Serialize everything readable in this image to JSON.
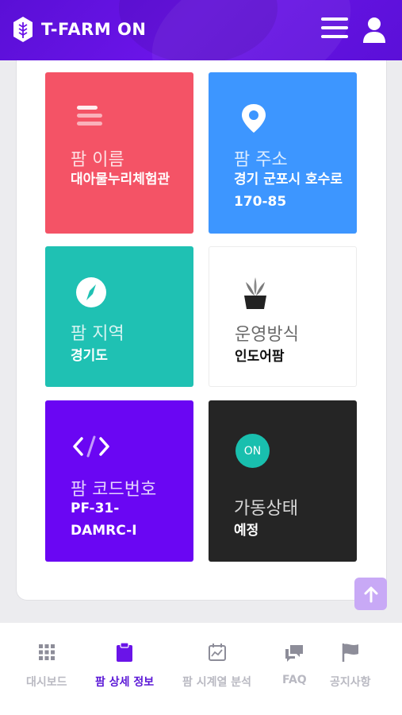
{
  "app": {
    "title": "T-FARM ON"
  },
  "cards": {
    "farm_name": {
      "title": "팜 이름",
      "value": "대아물누리체험관"
    },
    "farm_address": {
      "title": "팜 주소",
      "value": "경기 군포시 호수로 170-85"
    },
    "farm_region": {
      "title": "팜 지역",
      "value": "경기도"
    },
    "operation_method": {
      "title": "운영방식",
      "value": "인도어팜"
    },
    "farm_code": {
      "title": "팜 코드번호",
      "value": "PF-31-DAMRC-I"
    },
    "operation_status": {
      "title": "가동상태",
      "value": "예정",
      "badge": "ON"
    }
  },
  "nav": {
    "items": [
      {
        "label": "대시보드",
        "icon": "grid-icon",
        "active": false
      },
      {
        "label": "팜 상세 정보",
        "icon": "clipboard-icon",
        "active": true
      },
      {
        "label": "팜 시계열 분석",
        "icon": "calendar-chart-icon",
        "active": false
      },
      {
        "label": "FAQ",
        "icon": "chat-bubbles-icon",
        "active": false
      },
      {
        "label": "공지사항",
        "icon": "flag-icon",
        "active": false
      }
    ]
  },
  "colors": {
    "brand": "#6a14e8",
    "card_name": "#f45366",
    "card_address": "#3d96ff",
    "card_region": "#1fc1b3",
    "card_code": "#6a06f3",
    "card_status": "#252525",
    "nav_active": "#5a17d6"
  }
}
